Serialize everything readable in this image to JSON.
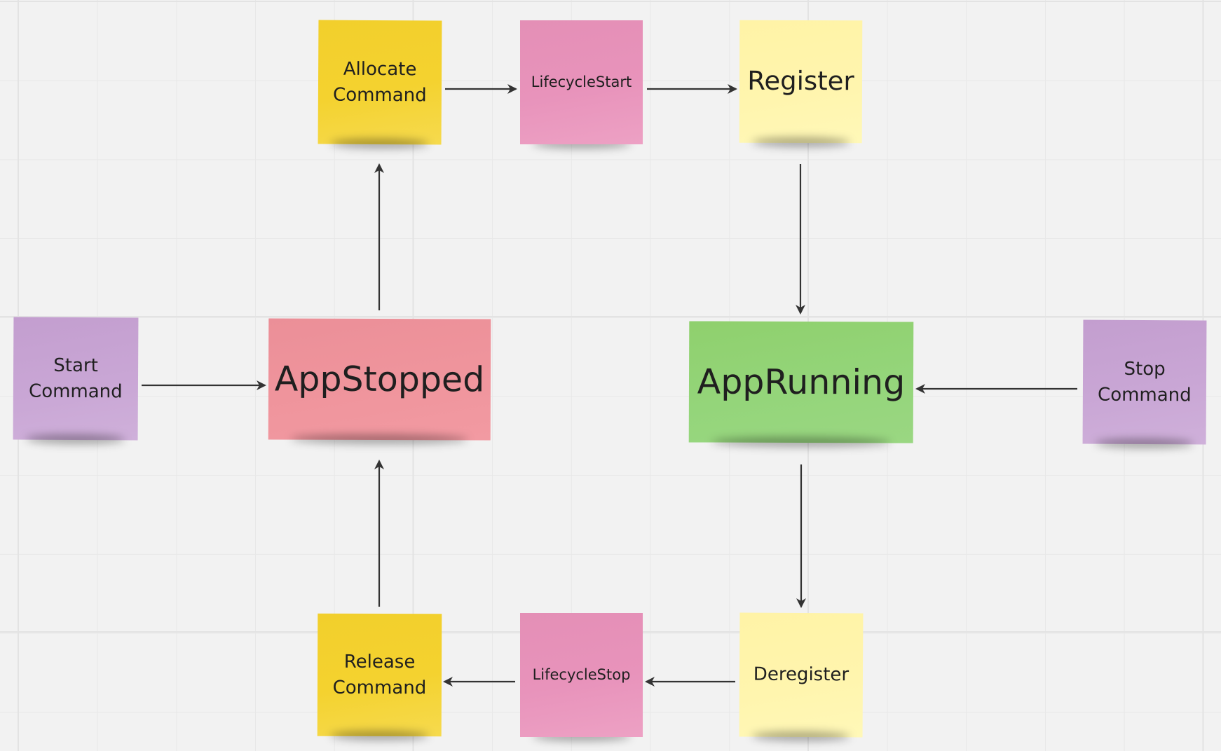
{
  "board": {
    "background": "#f2f2f2",
    "grid_color": "#e6e6e6"
  },
  "notes": {
    "allocate_command": {
      "label": "Allocate\nCommand",
      "color": "#f4d22f"
    },
    "lifecycle_start": {
      "label": "LifecycleStart",
      "color": "#e893bb"
    },
    "register": {
      "label": "Register",
      "color": "#fff5ae"
    },
    "start_command": {
      "label": "Start\nCommand",
      "color": "#c9a6d5"
    },
    "app_stopped": {
      "label": "AppStopped",
      "color": "#ef949c"
    },
    "app_running": {
      "label": "AppRunning",
      "color": "#94d57a"
    },
    "stop_command": {
      "label": "Stop\nCommand",
      "color": "#c9a6d5"
    },
    "release_command": {
      "label": "Release\nCommand",
      "color": "#f4d22f"
    },
    "lifecycle_stop": {
      "label": "LifecycleStop",
      "color": "#e893bb"
    },
    "deregister": {
      "label": "Deregister",
      "color": "#fff5ae"
    }
  },
  "connectors": [
    {
      "from": "start_command",
      "to": "app_stopped"
    },
    {
      "from": "app_stopped",
      "to": "allocate_command"
    },
    {
      "from": "allocate_command",
      "to": "lifecycle_start"
    },
    {
      "from": "lifecycle_start",
      "to": "register"
    },
    {
      "from": "register",
      "to": "app_running"
    },
    {
      "from": "stop_command",
      "to": "app_running"
    },
    {
      "from": "app_running",
      "to": "deregister"
    },
    {
      "from": "deregister",
      "to": "lifecycle_stop"
    },
    {
      "from": "lifecycle_stop",
      "to": "release_command"
    },
    {
      "from": "release_command",
      "to": "app_stopped"
    }
  ],
  "connector_color": "#333333"
}
